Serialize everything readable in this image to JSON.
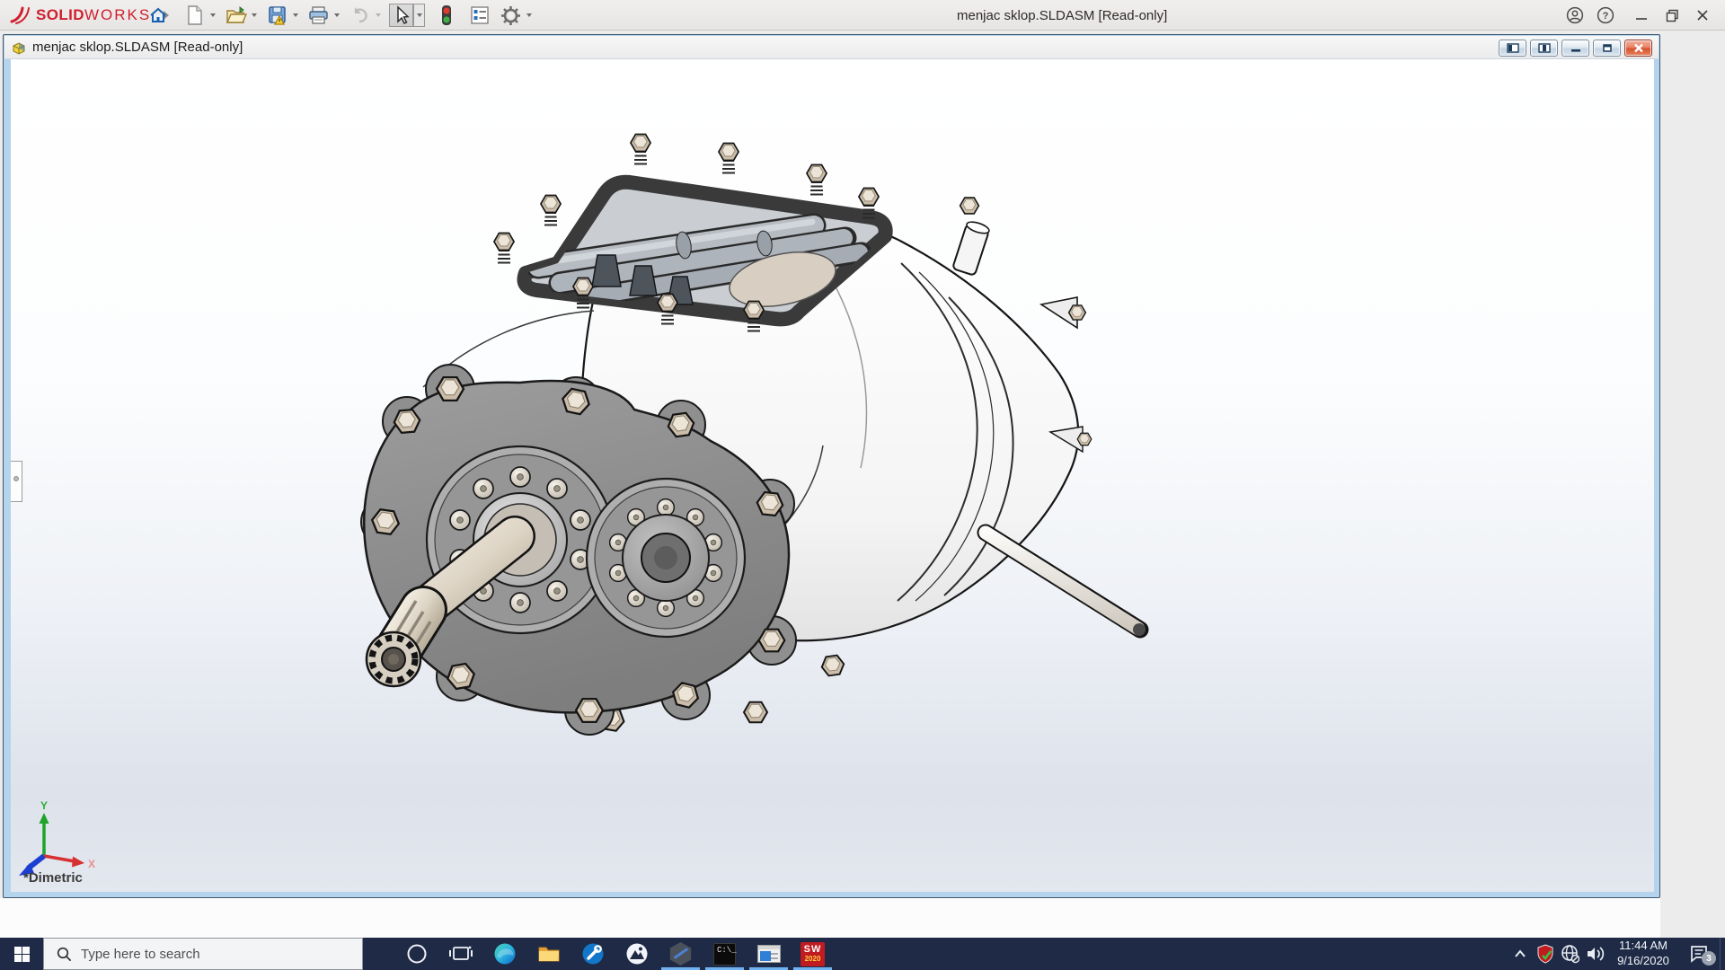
{
  "app_titlebar": {
    "brand": {
      "icon": "solidworks-logo-icon",
      "bold": "SOLID",
      "light": "WORKS"
    },
    "title": "menjac sklop.SLDASM [Read-only]",
    "toolbar": [
      {
        "name": "home-icon",
        "caret": false
      },
      {
        "name": "new-document-icon",
        "caret": true
      },
      {
        "name": "open-icon",
        "caret": true
      },
      {
        "name": "save-icon",
        "caret": true
      },
      {
        "name": "print-icon",
        "caret": true
      },
      {
        "name": "undo-icon",
        "caret": true,
        "disabled": true
      },
      {
        "name": "select-cursor-icon",
        "caret": true,
        "active": true
      },
      {
        "name": "rebuild-traffic-light-icon",
        "caret": false
      },
      {
        "name": "task-list-icon",
        "caret": false
      },
      {
        "name": "settings-gear-icon",
        "caret": true
      }
    ],
    "window_controls": [
      "account-icon",
      "help-icon",
      "minimize-icon",
      "maximize-icon",
      "close-icon"
    ]
  },
  "document_window": {
    "icon": "assembly-document-icon",
    "title": "menjac sklop.SLDASM [Read-only]",
    "controls": [
      "show-left-pane-icon",
      "show-right-pane-icon",
      "minimize-icon",
      "restore-icon",
      "close-icon"
    ]
  },
  "viewport": {
    "view_label": "*Dimetric",
    "model": "gearbox-assembly-3d-model",
    "triad": {
      "x": "X",
      "y": "Y"
    }
  },
  "taskbar": {
    "start_icon": "windows-start-icon",
    "search": {
      "icon": "search-icon",
      "placeholder": "Type here to search"
    },
    "app_icons": [
      {
        "name": "cortana-icon",
        "running": false
      },
      {
        "name": "task-view-icon",
        "running": false
      },
      {
        "name": "edge-icon",
        "running": false
      },
      {
        "name": "file-explorer-icon",
        "running": false
      },
      {
        "name": "tools-wrench-icon",
        "running": false
      },
      {
        "name": "photos-icon",
        "running": false
      },
      {
        "name": "hexagon-app-icon",
        "running": true
      },
      {
        "name": "command-prompt-icon",
        "running": true,
        "glyph": "C:\\_"
      },
      {
        "name": "panel-app-icon",
        "running": true
      },
      {
        "name": "solidworks-icon",
        "running": true,
        "sw": "SW",
        "year": "2020"
      }
    ],
    "tray": {
      "expand_icon": "tray-expand-icon",
      "icons": [
        "solidworks-shield-icon",
        "no-internet-icon",
        "volume-icon"
      ],
      "clock": {
        "time": "11:44 AM",
        "date": "9/16/2020"
      },
      "action_center": {
        "icon": "action-center-icon",
        "badge": "3"
      }
    }
  },
  "colors": {
    "brand_red": "#cf1f2f",
    "taskbar": "#1e2a46",
    "running_indicator": "#6fb2ef",
    "doc_frame_blue": "#b4d4ee"
  }
}
